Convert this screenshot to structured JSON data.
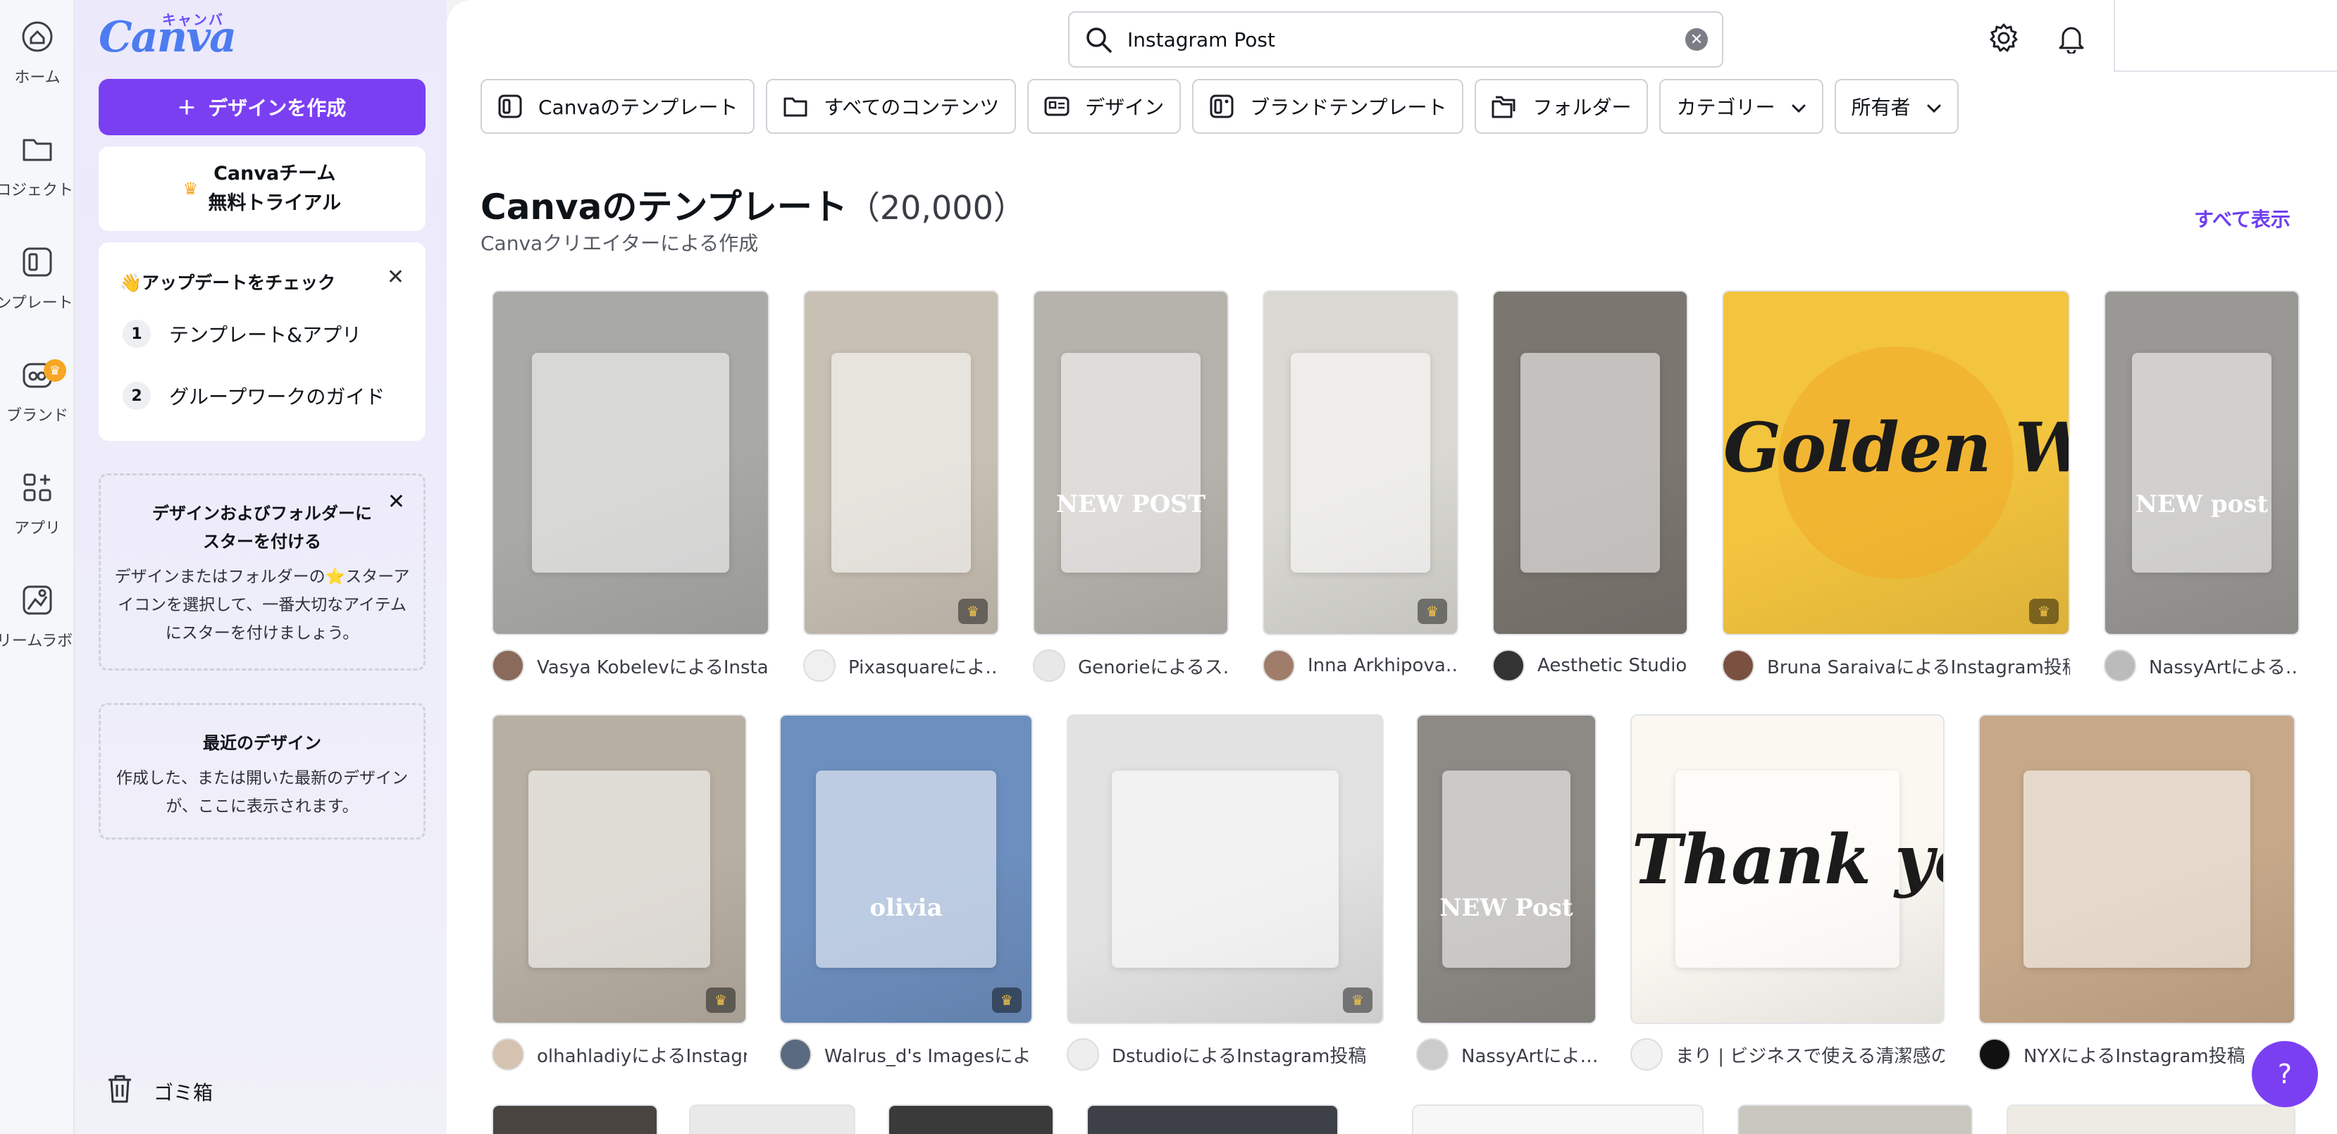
{
  "rail": {
    "items": [
      {
        "label": "ホーム",
        "icon": "home-icon"
      },
      {
        "label": "プロジェクト",
        "icon": "folder-icon"
      },
      {
        "label": "テンプレート",
        "icon": "template-icon"
      },
      {
        "label": "ブランド",
        "icon": "brand-icon",
        "badge": "♛"
      },
      {
        "label": "アプリ",
        "icon": "apps-icon"
      },
      {
        "label": "ドリームラボ",
        "icon": "dream-lab-icon"
      }
    ]
  },
  "panel": {
    "logo_kana": "キャンバ",
    "logo_word": "Canva",
    "create_label": "デザインを作成",
    "trial_text": "Canvaチーム\n無料トライアル",
    "updates": {
      "title": "👋アップデートをチェック",
      "steps": [
        {
          "num": "1",
          "label": "テンプレート&アプリ"
        },
        {
          "num": "2",
          "label": "グループワークのガイド"
        }
      ]
    },
    "star_card": {
      "heading": "デザインおよびフォルダーに\nスターを付ける",
      "body": "デザインまたはフォルダーの⭐スターア\nイコンを選択して、一番大切なアイテム\nにスターを付けましょう。"
    },
    "recent_card": {
      "heading": "最近のデザイン",
      "body": "作成した、または開いた最新のデザイン\nが、ここに表示されます。"
    },
    "trash_label": "ゴミ箱"
  },
  "search": {
    "value": "Instagram Post",
    "placeholder": ""
  },
  "filters": [
    {
      "label": "Canvaのテンプレート",
      "icon": "template-icon",
      "dropdown": false
    },
    {
      "label": "すべてのコンテンツ",
      "icon": "folder-icon",
      "dropdown": false
    },
    {
      "label": "デザイン",
      "icon": "design-icon",
      "dropdown": false
    },
    {
      "label": "ブランドテンプレート",
      "icon": "brand-template-icon",
      "dropdown": false
    },
    {
      "label": "フォルダー",
      "icon": "folders-icon",
      "dropdown": false
    },
    {
      "label": "カテゴリー",
      "icon": "",
      "dropdown": true
    },
    {
      "label": "所有者",
      "icon": "",
      "dropdown": true
    }
  ],
  "section": {
    "title": "Canvaのテンプレート",
    "count": "（20,000）",
    "subtitle": "Canvaクリエイターによる作成",
    "see_all": "すべて表示"
  },
  "templates_row1": [
    {
      "author": "Vasya KobelevによるInstag…",
      "bg": "#a9aaa6",
      "pro": false,
      "overlay": ""
    },
    {
      "author": "Pixasquareによ…",
      "bg": "#c9c0b4",
      "pro": true,
      "overlay": ""
    },
    {
      "author": "Genorieによるス…",
      "bg": "#b6b3ad",
      "pro": false,
      "overlay": "NEW POST"
    },
    {
      "author": "Inna Arkhipova…",
      "bg": "#d9d8d2",
      "pro": true,
      "overlay": ""
    },
    {
      "author": "Aesthetic Studio…",
      "bg": "#7c7670",
      "pro": false,
      "overlay": ""
    },
    {
      "author": "Bruna SaraivaによるInstagram投稿",
      "bg": "#f3c43e",
      "pro": true,
      "overlay": "Golden Week"
    },
    {
      "author": "NassyArtによる…",
      "bg": "#9a9894",
      "pro": false,
      "overlay": "NEW post"
    }
  ],
  "templates_row2": [
    {
      "author": "olhahladiyによるInstagr…",
      "bg": "#b8afa3",
      "pro": true,
      "overlay": ""
    },
    {
      "author": "Walrus_d's Imagesによ…",
      "bg": "#6d8fbf",
      "pro": true,
      "overlay": "olivia"
    },
    {
      "author": "DstudioによるInstagram投稿",
      "bg": "#e2e2e2",
      "pro": true,
      "overlay": ""
    },
    {
      "author": "NassyArtによ…",
      "bg": "#8d8a85",
      "pro": false,
      "overlay": "NEW Post"
    },
    {
      "author": "まり | ビジネスで使える清潔感の…",
      "bg": "#fbf8f2",
      "pro": false,
      "overlay": "Thank you!"
    },
    {
      "author": "NYXによるInstagram投稿",
      "bg": "#c7a98a",
      "pro": false,
      "overlay": ""
    }
  ],
  "help_label": "?"
}
